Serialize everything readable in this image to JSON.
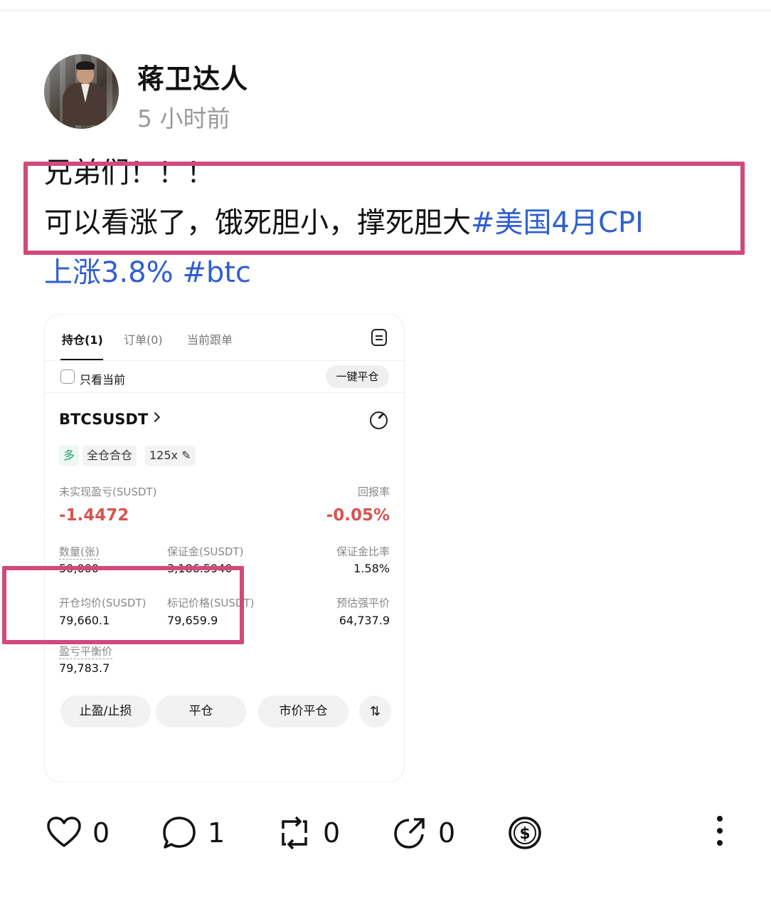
{
  "author": {
    "name": "蒋卫达人",
    "time": "5 小时前"
  },
  "post": {
    "line1": "兄弟们！！！",
    "line2_text": "可以看涨了，饿死胆小，撑死胆大",
    "line2_tag": "#美国4月CPI",
    "line3_tag1": "上涨3.8%",
    "line3_tag2": "#btc"
  },
  "card": {
    "tabs": [
      "持仓(1)",
      "订单(0)",
      "当前跟单"
    ],
    "only_current": "只看当前",
    "close_all": "一键平仓",
    "symbol": "BTCSUSDT",
    "tags": {
      "side": "多",
      "mode": "全仓合仓",
      "leverage": "125x"
    },
    "unrealized_label": "未实现盈亏(SUSDT)",
    "unrealized_value": "-1.4472",
    "roi_label": "回报率",
    "roi_value": "-0.05%",
    "qty_label": "数量(张)",
    "qty_value": "50,000",
    "margin_label": "保证金(SUSDT)",
    "margin_value": "3,186.5940",
    "margin_ratio_label": "保证金比率",
    "margin_ratio_value": "1.58%",
    "entry_label": "开仓均价(SUSDT)",
    "entry_value": "79,660.1",
    "mark_label": "标记价格(SUSDT)",
    "mark_value": "79,659.9",
    "liq_label": "预估强平价",
    "liq_value": "64,737.9",
    "breakeven_label": "盈亏平衡价",
    "breakeven_value": "79,783.7",
    "buttons": [
      "止盈/止损",
      "平仓",
      "市价平仓"
    ]
  },
  "footer": {
    "likes": "0",
    "comments": "1",
    "reposts": "0",
    "shares": "0"
  },
  "colors": {
    "hashtag": "#2f5fd1",
    "annotation": "#d04a7c",
    "loss": "#d9534f",
    "long": "#26a269"
  }
}
